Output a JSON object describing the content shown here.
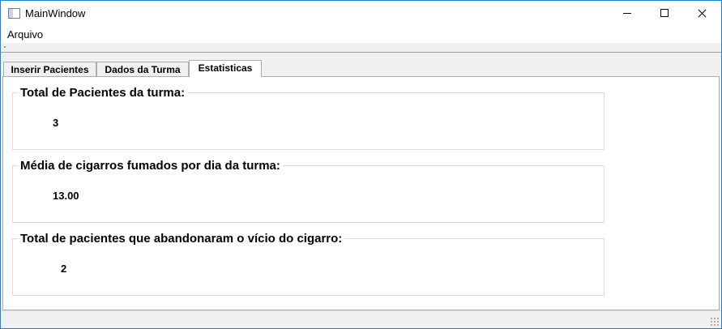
{
  "window": {
    "title": "MainWindow"
  },
  "menubar": {
    "items": [
      "Arquivo"
    ]
  },
  "tabs": [
    {
      "label": "Inserir Pacientes",
      "active": false
    },
    {
      "label": "Dados da Turma",
      "active": false
    },
    {
      "label": "Estatisticas",
      "active": true
    }
  ],
  "stats": {
    "total_patients": {
      "title": "Total de Pacientes da turma:",
      "value": "3"
    },
    "avg_cigarettes": {
      "title": "Média de cigarros fumados por dia da turma:",
      "value": "13.00"
    },
    "quit_smoking": {
      "title": "Total de pacientes que abandonaram o vício do cigarro:",
      "value": "2"
    }
  }
}
